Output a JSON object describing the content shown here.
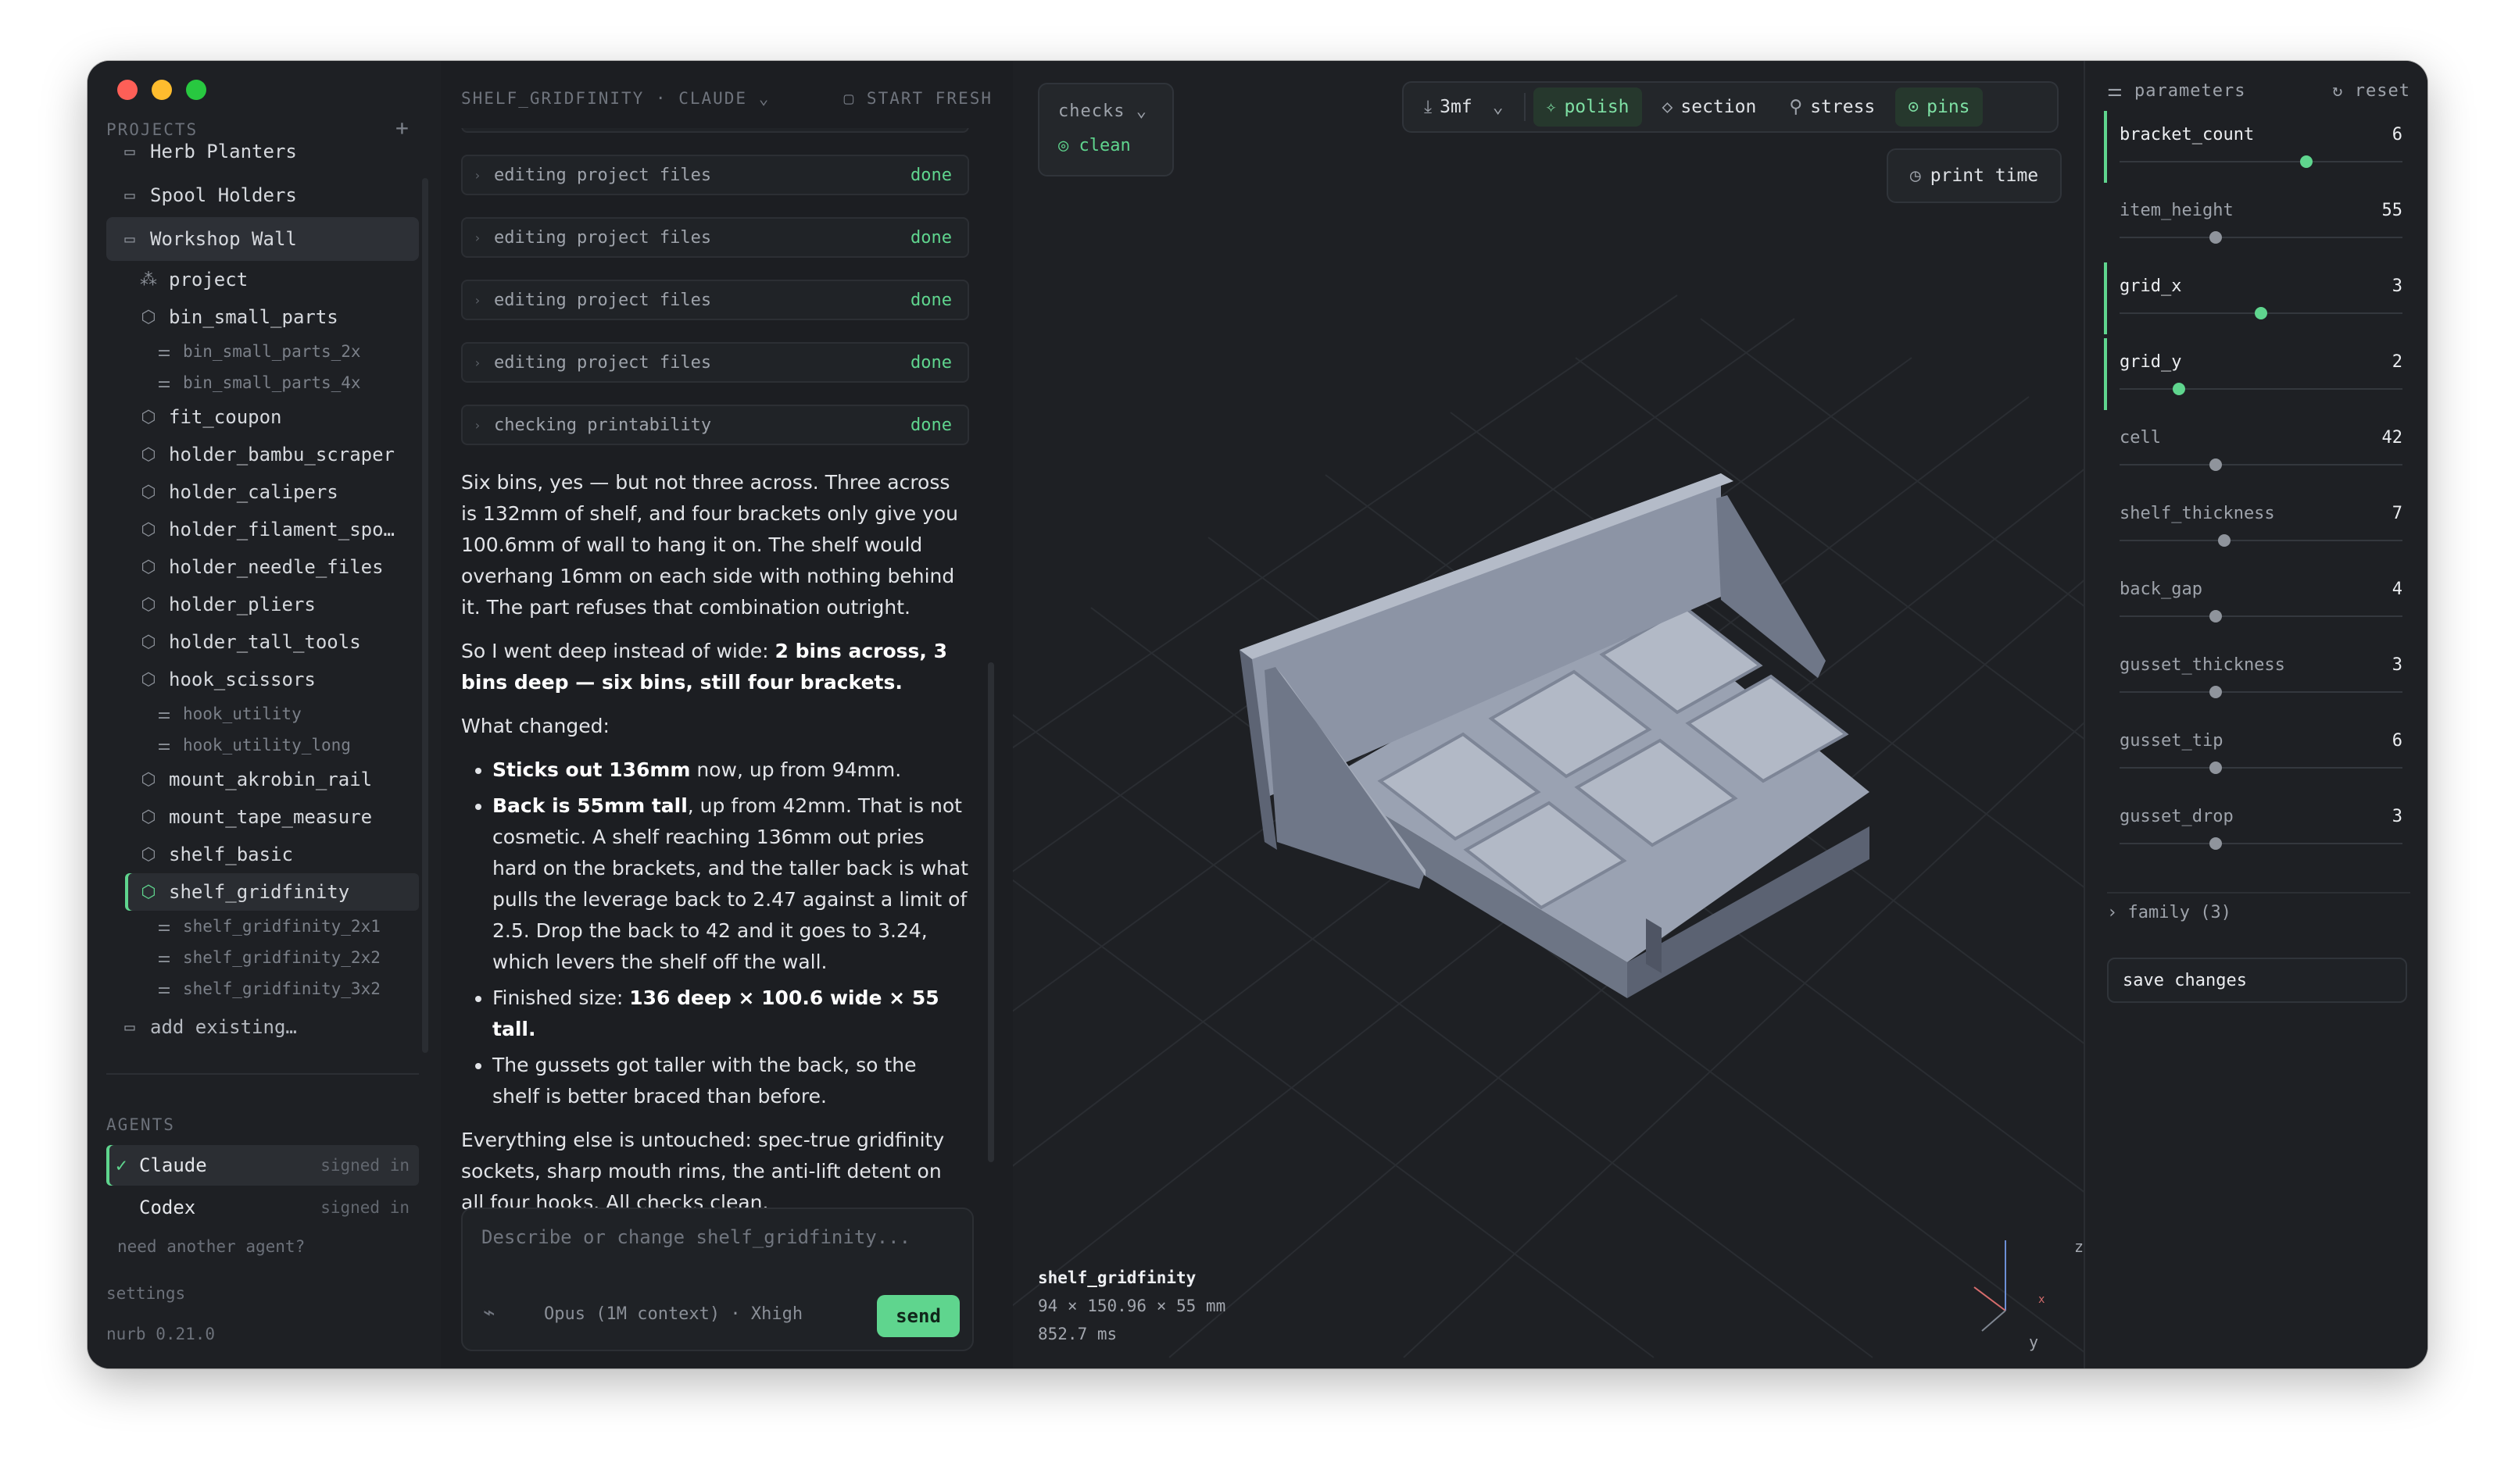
{
  "sidebar": {
    "projects_label": "PROJECTS",
    "add_label": "+",
    "folders_top": [
      {
        "label": "Herb Planters"
      },
      {
        "label": "Spool Holders"
      },
      {
        "label": "Workshop Wall"
      }
    ],
    "items": [
      {
        "label": "project",
        "kind": "child",
        "icon": "project-icon"
      },
      {
        "label": "bin_small_parts",
        "kind": "child",
        "icon": "cube-icon"
      },
      {
        "label": "bin_small_parts_2x",
        "kind": "variant",
        "icon": "sliders-icon"
      },
      {
        "label": "bin_small_parts_4x",
        "kind": "variant",
        "icon": "sliders-icon"
      },
      {
        "label": "fit_coupon",
        "kind": "child",
        "icon": "cube-icon"
      },
      {
        "label": "holder_bambu_scraper",
        "kind": "child",
        "icon": "cube-icon"
      },
      {
        "label": "holder_calipers",
        "kind": "child",
        "icon": "cube-icon"
      },
      {
        "label": "holder_filament_spo…",
        "kind": "child",
        "icon": "cube-icon"
      },
      {
        "label": "holder_needle_files",
        "kind": "child",
        "icon": "cube-icon"
      },
      {
        "label": "holder_pliers",
        "kind": "child",
        "icon": "cube-icon"
      },
      {
        "label": "holder_tall_tools",
        "kind": "child",
        "icon": "cube-icon"
      },
      {
        "label": "hook_scissors",
        "kind": "child",
        "icon": "cube-icon"
      },
      {
        "label": "hook_utility",
        "kind": "variant",
        "icon": "sliders-icon"
      },
      {
        "label": "hook_utility_long",
        "kind": "variant",
        "icon": "sliders-icon"
      },
      {
        "label": "mount_akrobin_rail",
        "kind": "child",
        "icon": "cube-icon"
      },
      {
        "label": "mount_tape_measure",
        "kind": "child",
        "icon": "cube-icon"
      },
      {
        "label": "shelf_basic",
        "kind": "child",
        "icon": "cube-icon"
      },
      {
        "label": "shelf_gridfinity",
        "kind": "selected",
        "icon": "cube-icon"
      },
      {
        "label": "shelf_gridfinity_2x1",
        "kind": "variant",
        "icon": "sliders-icon"
      },
      {
        "label": "shelf_gridfinity_2x2",
        "kind": "variant",
        "icon": "sliders-icon"
      },
      {
        "label": "shelf_gridfinity_3x2",
        "kind": "variant",
        "icon": "sliders-icon"
      }
    ],
    "add_existing": "add existing…",
    "agents_label": "AGENTS",
    "agents": [
      {
        "name": "Claude",
        "status": "signed in",
        "active": true
      },
      {
        "name": "Codex",
        "status": "signed in",
        "active": false
      }
    ],
    "need_agent": "need another agent?",
    "settings": "settings",
    "version": "nurb 0.21.0"
  },
  "chat": {
    "header_title": "SHELF_GRIDFINITY · CLAUDE",
    "start_fresh": "START FRESH",
    "tool_calls": [
      {
        "label": "editing project files",
        "status": "done"
      },
      {
        "label": "editing project files",
        "status": "done"
      },
      {
        "label": "editing project files",
        "status": "done"
      },
      {
        "label": "editing project files",
        "status": "done"
      },
      {
        "label": "editing project files",
        "status": "done"
      },
      {
        "label": "checking printability",
        "status": "done"
      }
    ],
    "p1": "Six bins, yes — but not three across. Three across is 132mm of shelf, and four brackets only give you 100.6mm of wall to hang it on. The shelf would overhang 16mm on each side with nothing behind it. The part refuses that combination outright.",
    "p2_pre": "So I went deep instead of wide: ",
    "p2_bold": "2 bins across, 3 bins deep — six bins, still four brackets.",
    "p3": "What changed:",
    "b1_bold": "Sticks out 136mm",
    "b1_rest": " now, up from 94mm.",
    "b2_bold": "Back is 55mm tall",
    "b2_rest": ", up from 42mm. That is not cosmetic. A shelf reaching 136mm out pries hard on the brackets, and the taller back is what pulls the leverage back to 2.47 against a limit of 2.5. Drop the back to 42 and it goes to 3.24, which levers the shelf off the wall.",
    "b3_pre": "Finished size: ",
    "b3_bold": "136 deep × 100.6 wide × 55 tall.",
    "b4": "The gussets got taller with the back, so the shelf is better braced than before.",
    "p4": "Everything else is untouched: spec-true gridfinity sockets, sharp mouth rims, the anti-lift detent on all four hooks. All checks clean.",
    "composer_placeholder": "Describe or change shelf_gridfinity...",
    "model": "Opus (1M context) · Xhigh",
    "send": "send"
  },
  "viewport": {
    "checks_label": "checks",
    "checks_status": "clean",
    "toolbar": {
      "export": "3mf",
      "polish": "polish",
      "section": "section",
      "stress": "stress",
      "pins": "pins"
    },
    "print_time": "print time",
    "part_name": "shelf_gridfinity",
    "part_dims": "94 × 150.96 × 55 mm",
    "part_time": "852.7 ms",
    "axes": {
      "z": "z",
      "x": "x",
      "y": "y"
    },
    "colors": {
      "accent": "#5fd58e",
      "model": "#8a93a5"
    }
  },
  "params": {
    "title": "parameters",
    "reset": "reset",
    "items": [
      {
        "name": "bracket_count",
        "value": "6",
        "level": 0.66,
        "changed": true
      },
      {
        "name": "item_height",
        "value": "55",
        "level": 0.34,
        "changed": false
      },
      {
        "name": "grid_x",
        "value": "3",
        "level": 0.5,
        "changed": true
      },
      {
        "name": "grid_y",
        "value": "2",
        "level": 0.21,
        "changed": true
      },
      {
        "name": "cell",
        "value": "42",
        "level": 0.34,
        "changed": false
      },
      {
        "name": "shelf_thickness",
        "value": "7",
        "level": 0.37,
        "changed": false
      },
      {
        "name": "back_gap",
        "value": "4",
        "level": 0.34,
        "changed": false
      },
      {
        "name": "gusset_thickness",
        "value": "3",
        "level": 0.34,
        "changed": false
      },
      {
        "name": "gusset_tip",
        "value": "6",
        "level": 0.34,
        "changed": false
      },
      {
        "name": "gusset_drop",
        "value": "3",
        "level": 0.34,
        "changed": false
      }
    ],
    "family": "family (3)",
    "save": "save changes"
  }
}
